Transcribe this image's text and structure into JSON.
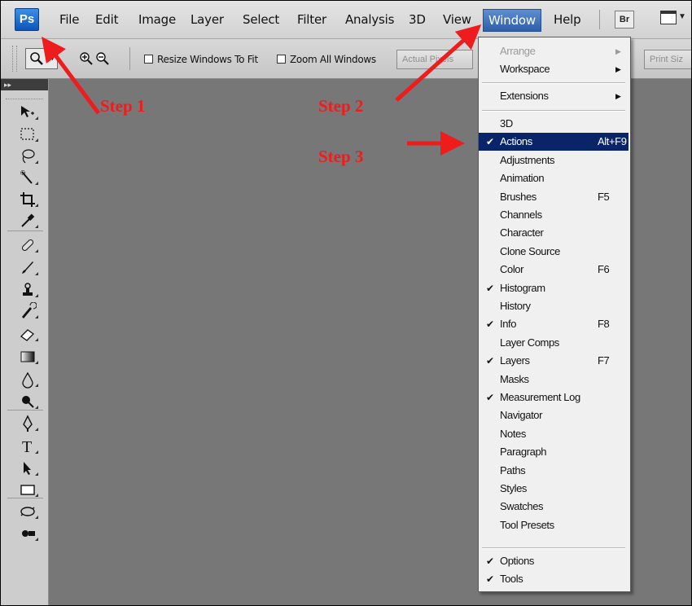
{
  "app": {
    "logo": "Ps",
    "menus": [
      "File",
      "Edit",
      "Image",
      "Layer",
      "Select",
      "Filter",
      "Analysis",
      "3D",
      "View",
      "Window",
      "Help"
    ],
    "active_menu": "Window",
    "bridge_button": "Br"
  },
  "options_bar": {
    "resize_windows": "Resize Windows To Fit",
    "zoom_all_windows": "Zoom All Windows",
    "actual_pixels": "Actual Pixels",
    "print_size": "Print Siz"
  },
  "window_menu": {
    "group1": [
      {
        "label": "Arrange",
        "disabled": true,
        "submenu": true
      },
      {
        "label": "Workspace",
        "submenu": true
      }
    ],
    "group2": [
      {
        "label": "Extensions",
        "submenu": true
      }
    ],
    "group3": [
      {
        "label": "3D"
      },
      {
        "label": "Actions",
        "shortcut": "Alt+F9",
        "checked": true,
        "highlighted": true
      },
      {
        "label": "Adjustments"
      },
      {
        "label": "Animation"
      },
      {
        "label": "Brushes",
        "shortcut": "F5"
      },
      {
        "label": "Channels"
      },
      {
        "label": "Character"
      },
      {
        "label": "Clone Source"
      },
      {
        "label": "Color",
        "shortcut": "F6"
      },
      {
        "label": "Histogram",
        "checked": true
      },
      {
        "label": "History"
      },
      {
        "label": "Info",
        "shortcut": "F8",
        "checked": true
      },
      {
        "label": "Layer Comps"
      },
      {
        "label": "Layers",
        "shortcut": "F7",
        "checked": true
      },
      {
        "label": "Masks"
      },
      {
        "label": "Measurement Log",
        "checked": true
      },
      {
        "label": "Navigator"
      },
      {
        "label": "Notes"
      },
      {
        "label": "Paragraph"
      },
      {
        "label": "Paths"
      },
      {
        "label": "Styles"
      },
      {
        "label": "Swatches"
      },
      {
        "label": "Tool Presets"
      }
    ],
    "group4": [
      {
        "label": "Options",
        "checked": true
      },
      {
        "label": "Tools",
        "checked": true
      }
    ]
  },
  "annotations": {
    "step1": "Step 1",
    "step2": "Step 2",
    "step3": "Step 3"
  },
  "colors": {
    "annotation": "#ee1c1c",
    "highlight": "#0a246a",
    "canvas": "#777777"
  },
  "tools": [
    "move-tool",
    "marquee-tool",
    "lasso-tool",
    "quick-selection-tool",
    "crop-tool",
    "eyedropper-tool",
    "healing-brush-tool",
    "brush-tool",
    "clone-stamp-tool",
    "history-brush-tool",
    "eraser-tool",
    "gradient-tool",
    "blur-tool",
    "dodge-tool",
    "pen-tool",
    "type-tool",
    "path-selection-tool",
    "shape-tool",
    "3d-rotate-tool",
    "3d-camera-tool"
  ]
}
